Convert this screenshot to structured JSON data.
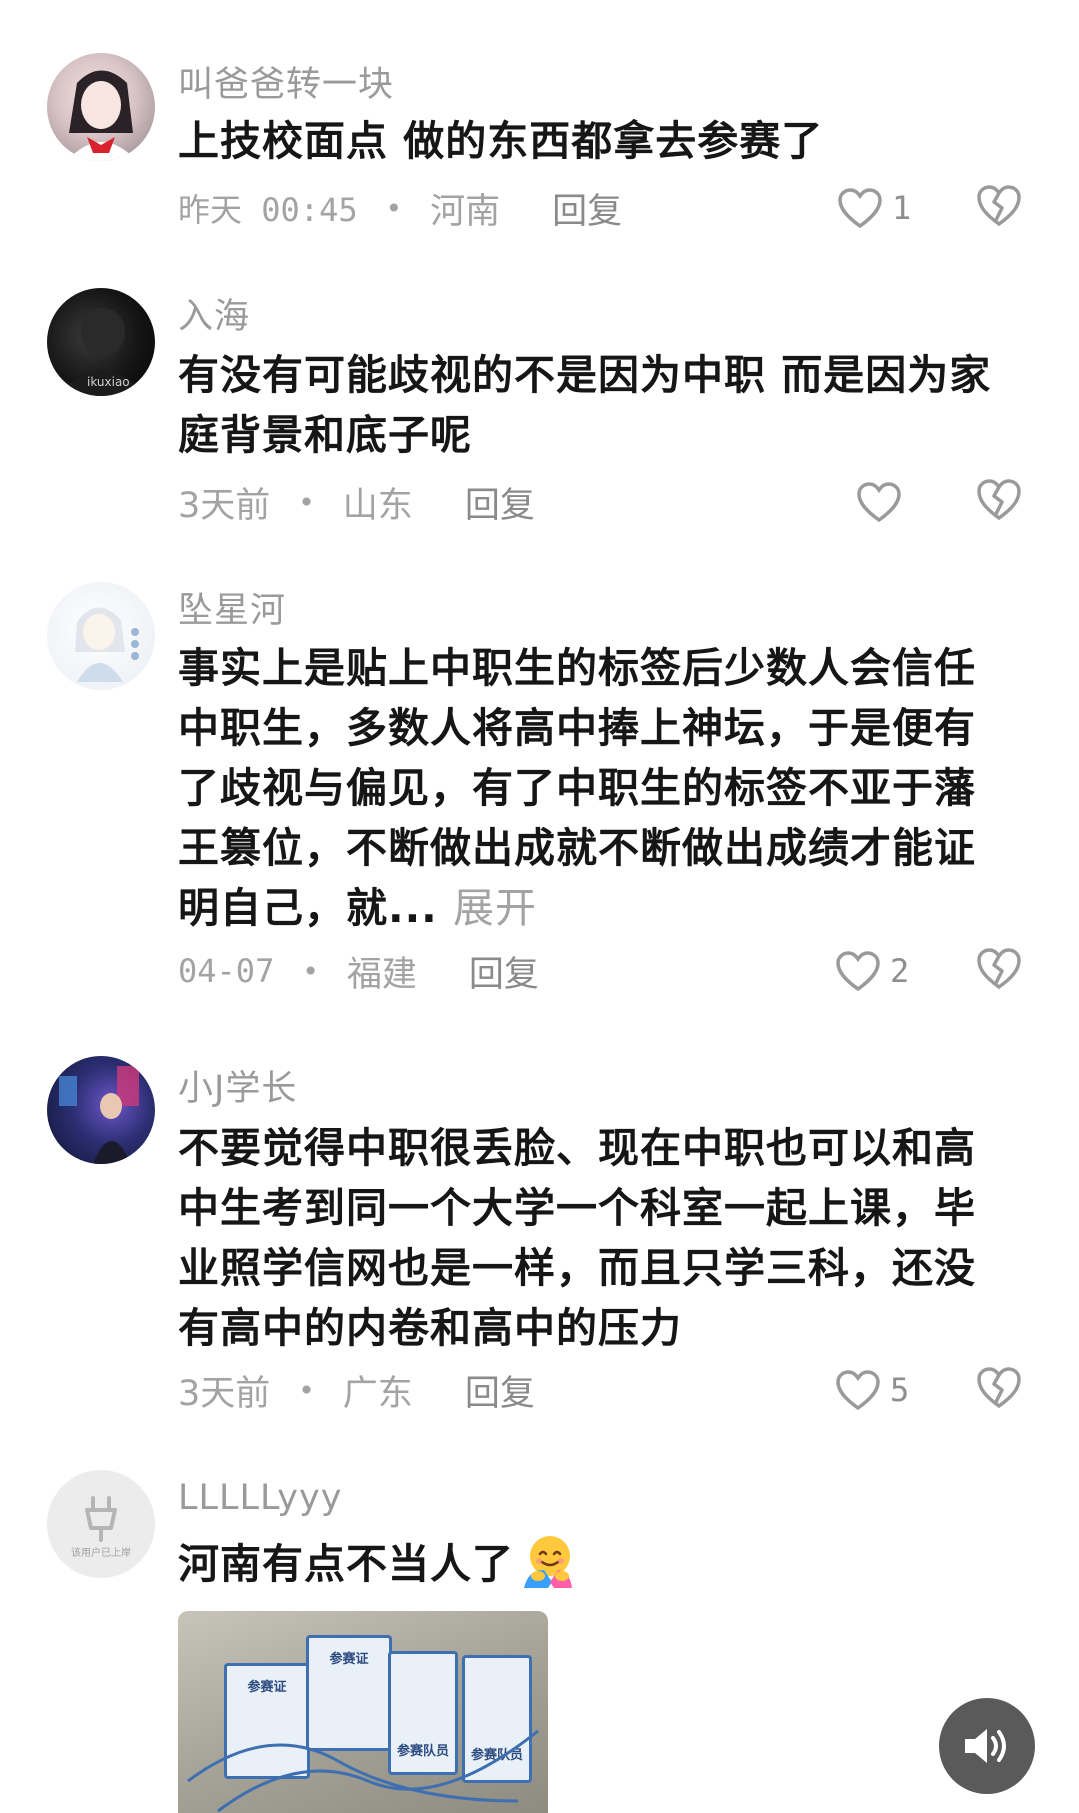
{
  "comments": [
    {
      "username": "叫爸爸转一块",
      "text": "上技校面点 做的东西都拿去参赛了",
      "time": "昨天 00:45",
      "location": "河南",
      "reply": "回复",
      "likes": "1"
    },
    {
      "username": "入海",
      "text": "有没有可能歧视的不是因为中职 而是因为家庭背景和底子呢",
      "time": "3天前",
      "location": "山东",
      "reply": "回复",
      "likes": ""
    },
    {
      "username": "坠星河",
      "text": "事实上是贴上中职生的标签后少数人会信任中职生，多数人将高中捧上神坛，于是便有了歧视与偏见，有了中职生的标签不亚于藩王篡位，不断做出成就不断做出成绩才能证明自己，就...",
      "expand": "展开",
      "time": "04-07",
      "location": "福建",
      "reply": "回复",
      "likes": "2"
    },
    {
      "username": "小J学长",
      "text": "不要觉得中职很丢脸、现在中职也可以和高中生考到同一个大学一个科室一起上课，毕业照学信网也是一样，而且只学三科，还没有高中的内卷和高中的压力",
      "time": "3天前",
      "location": "广东",
      "reply": "回复",
      "likes": "5"
    },
    {
      "username": "LLLLLyyy",
      "text": "河南有点不当人了",
      "emoji": "hugging-face-emoji",
      "avatar_text": "该用户已上岸",
      "photo_badges": [
        "参赛证",
        "参赛证",
        "参赛队员",
        "参赛队员"
      ]
    }
  ],
  "icons": {
    "like": "heart-outline-icon",
    "dislike": "broken-heart-icon",
    "sound": "speaker-icon"
  },
  "colors": {
    "text": "#161616",
    "secondary": "#9a9a9a",
    "sound_button": "#5a5a5a"
  }
}
